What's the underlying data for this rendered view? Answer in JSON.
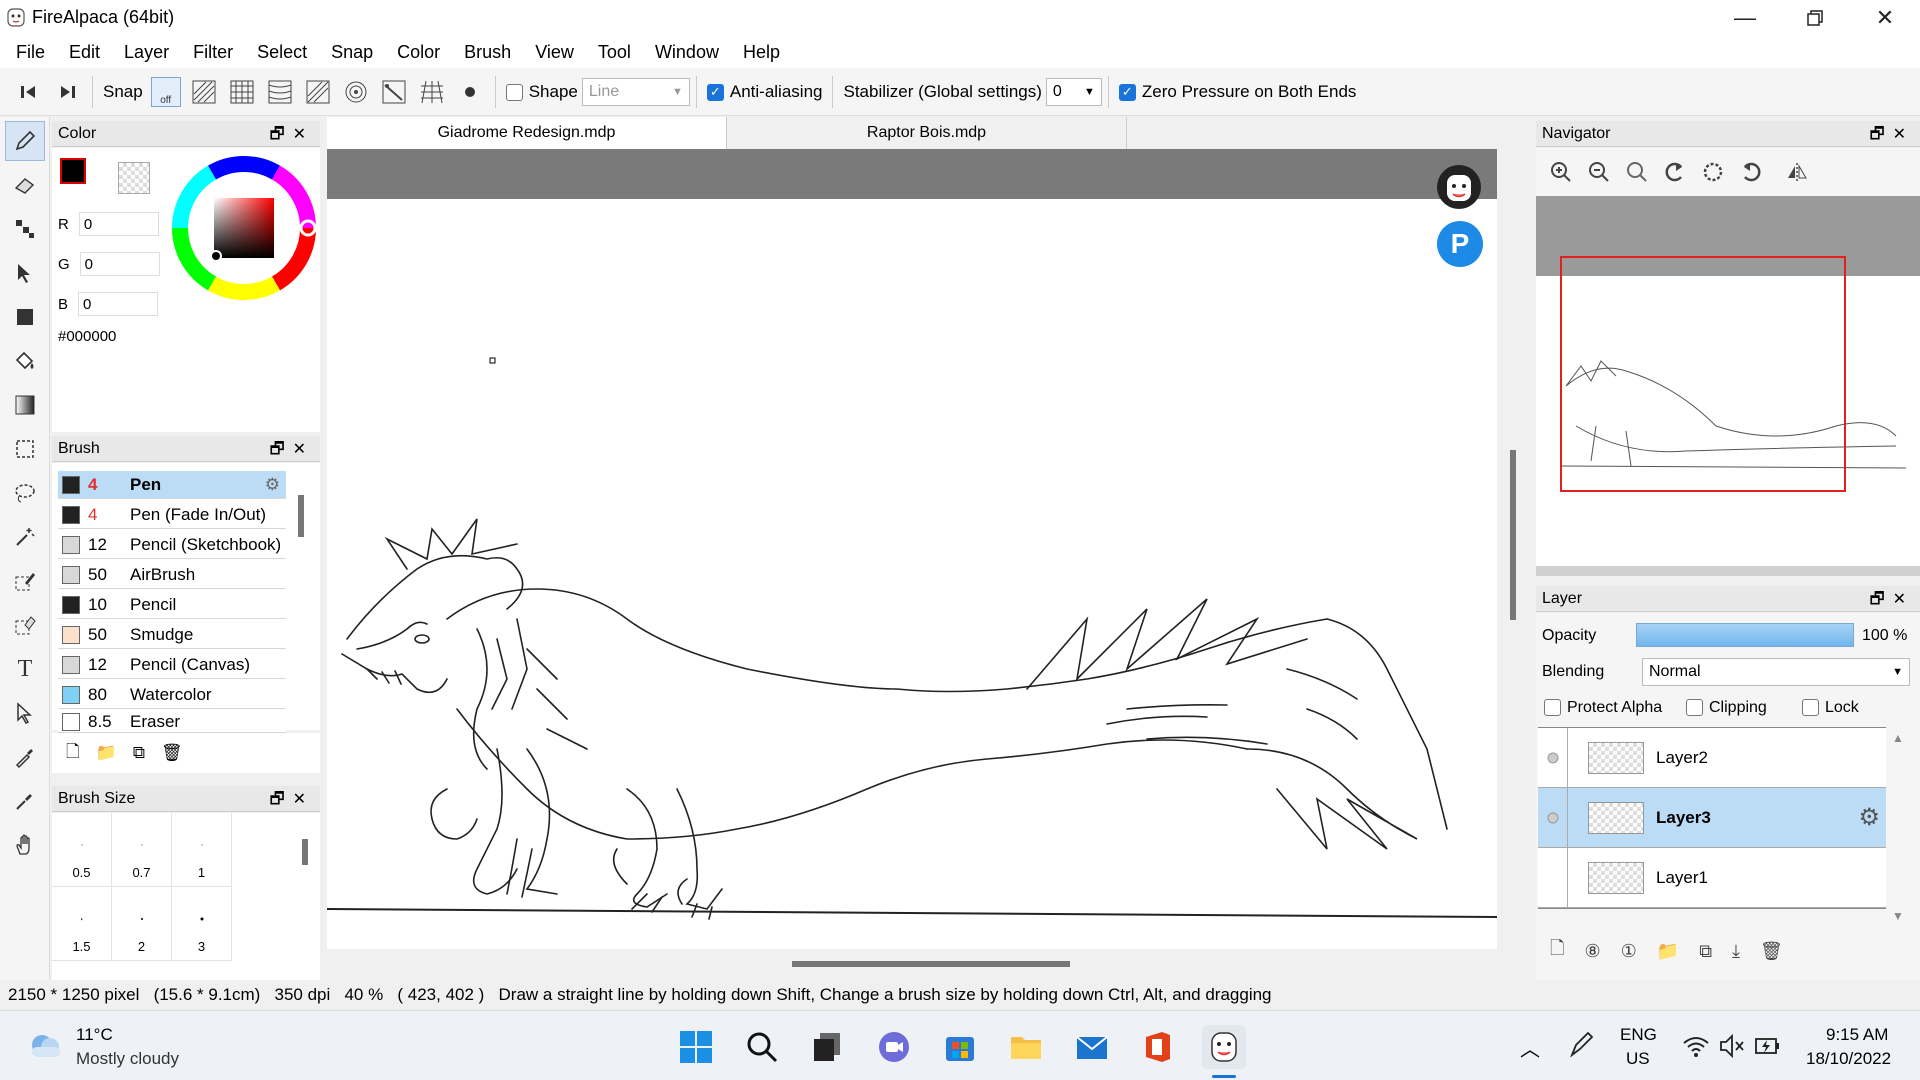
{
  "window": {
    "title": "FireAlpaca (64bit)"
  },
  "menu": [
    "File",
    "Edit",
    "Layer",
    "Filter",
    "Select",
    "Snap",
    "Color",
    "Brush",
    "View",
    "Tool",
    "Window",
    "Help"
  ],
  "toolbar": {
    "snap_label": "Snap",
    "snap_off_label": "off",
    "shape_label": "Shape",
    "shape_value": "Line",
    "antialias_label": "Anti-aliasing",
    "antialias_checked": true,
    "stabilizer_label": "Stabilizer (Global settings)",
    "stabilizer_value": "0",
    "zero_pressure_label": "Zero Pressure on Both Ends",
    "zero_pressure_checked": true
  },
  "color_panel": {
    "title": "Color",
    "r_label": "R",
    "r": "0",
    "g_label": "G",
    "g": "0",
    "b_label": "B",
    "b": "0",
    "hex": "#000000",
    "primary_color": "#000000"
  },
  "brush_panel": {
    "title": "Brush",
    "items": [
      {
        "size": "4",
        "name": "Pen",
        "color": "#222222",
        "active": true
      },
      {
        "size": "4",
        "name": "Pen (Fade In/Out)",
        "color": "#222222"
      },
      {
        "size": "12",
        "name": "Pencil (Sketchbook)",
        "color": "#d8d8d8"
      },
      {
        "size": "50",
        "name": "AirBrush",
        "color": "#d8d8d8"
      },
      {
        "size": "10",
        "name": "Pencil",
        "color": "#222222"
      },
      {
        "size": "50",
        "name": "Smudge",
        "color": "#fbe0cc"
      },
      {
        "size": "12",
        "name": "Pencil (Canvas)",
        "color": "#d8d8d8"
      },
      {
        "size": "80",
        "name": "Watercolor",
        "color": "#7fd0f5"
      },
      {
        "size": "8.5",
        "name": "Eraser",
        "color": "#ffffff"
      }
    ]
  },
  "brush_size_panel": {
    "title": "Brush Size",
    "sizes": [
      "0.5",
      "0.7",
      "1",
      "1.5",
      "2",
      "3"
    ]
  },
  "tabs": [
    {
      "label": "Giadrome Redesign.mdp",
      "active": true
    },
    {
      "label": "Raptor Bois.mdp",
      "active": false
    }
  ],
  "navigator": {
    "title": "Navigator"
  },
  "layer_panel": {
    "title": "Layer",
    "opacity_label": "Opacity",
    "opacity_value": "100 %",
    "opacity_fraction": 1.0,
    "blending_label": "Blending",
    "blending_value": "Normal",
    "protect_alpha_label": "Protect Alpha",
    "clipping_label": "Clipping",
    "lock_label": "Lock",
    "layers": [
      {
        "name": "Layer2",
        "active": false
      },
      {
        "name": "Layer3",
        "active": true
      },
      {
        "name": "Layer1",
        "active": false
      }
    ]
  },
  "status": {
    "canvas_size": "2150 * 1250 pixel",
    "physical_size": "(15.6 * 9.1cm)",
    "dpi": "350 dpi",
    "zoom": "40 %",
    "cursor": "( 423, 402 )",
    "hint": "Draw a straight line by holding down Shift, Change a brush size by holding down Ctrl, Alt, and dragging"
  },
  "taskbar": {
    "weather_temp": "11°C",
    "weather_desc": "Mostly cloudy",
    "lang_top": "ENG",
    "lang_bottom": "US",
    "time": "9:15 AM",
    "date": "18/10/2022"
  }
}
